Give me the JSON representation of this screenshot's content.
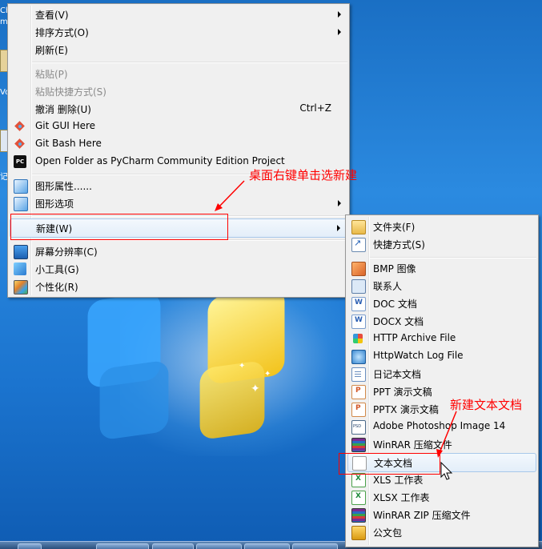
{
  "context_menu": {
    "items": [
      {
        "label": "查看(V)",
        "submenu": true
      },
      {
        "label": "排序方式(O)",
        "submenu": true
      },
      {
        "label": "刷新(E)"
      },
      {
        "label": "粘贴(P)",
        "disabled": true
      },
      {
        "label": "粘贴快捷方式(S)",
        "disabled": true
      },
      {
        "label": "撤消 删除(U)",
        "shortcut": "Ctrl+Z"
      },
      {
        "label": "Git GUI Here",
        "icon": "git-icon"
      },
      {
        "label": "Git Bash Here",
        "icon": "git-icon"
      },
      {
        "label": "Open Folder as PyCharm Community Edition Project",
        "icon": "pycharm-icon"
      },
      {
        "label": "图形属性......",
        "icon": "graphics-properties-icon"
      },
      {
        "label": "图形选项",
        "icon": "graphics-options-icon",
        "submenu": true
      },
      {
        "label": "新建(W)",
        "submenu": true,
        "highlighted": true
      },
      {
        "label": "屏幕分辨率(C)",
        "icon": "screen-resolution-icon"
      },
      {
        "label": "小工具(G)",
        "icon": "gadgets-icon"
      },
      {
        "label": "个性化(R)",
        "icon": "personalize-icon"
      }
    ],
    "pycharm_icon_text": "PC"
  },
  "new_submenu": {
    "items": [
      {
        "label": "文件夹(F)",
        "icon": "folder-icon"
      },
      {
        "label": "快捷方式(S)",
        "icon": "shortcut-icon"
      },
      {
        "label": "BMP 图像",
        "icon": "bmp-image-icon"
      },
      {
        "label": "联系人",
        "icon": "contact-icon"
      },
      {
        "label": "DOC 文档",
        "icon": "doc-document-icon"
      },
      {
        "label": "DOCX 文档",
        "icon": "docx-document-icon"
      },
      {
        "label": "HTTP Archive File",
        "icon": "http-archive-icon"
      },
      {
        "label": "HttpWatch Log File",
        "icon": "httpwatch-log-icon"
      },
      {
        "label": "日记本文档",
        "icon": "journal-document-icon"
      },
      {
        "label": "PPT 演示文稿",
        "icon": "ppt-icon"
      },
      {
        "label": "PPTX 演示文稿",
        "icon": "pptx-icon"
      },
      {
        "label": "Adobe Photoshop Image 14",
        "icon": "photoshop-image-icon"
      },
      {
        "label": "WinRAR 压缩文件",
        "icon": "winrar-archive-icon"
      },
      {
        "label": "文本文档",
        "icon": "text-document-icon",
        "highlighted": true
      },
      {
        "label": "XLS 工作表",
        "icon": "xls-icon"
      },
      {
        "label": "XLSX 工作表",
        "icon": "xlsx-icon"
      },
      {
        "label": "WinRAR ZIP 压缩文件",
        "icon": "winrar-zip-icon"
      },
      {
        "label": "公文包",
        "icon": "briefcase-icon"
      }
    ]
  },
  "annotations": {
    "right_click_note": "桌面右键单击选新建",
    "new_text_note": "新建文本文档",
    "color": "#ff0000"
  },
  "desktop": {
    "left_fragments": [
      "Ch",
      "m",
      "Vo",
      "记"
    ]
  }
}
